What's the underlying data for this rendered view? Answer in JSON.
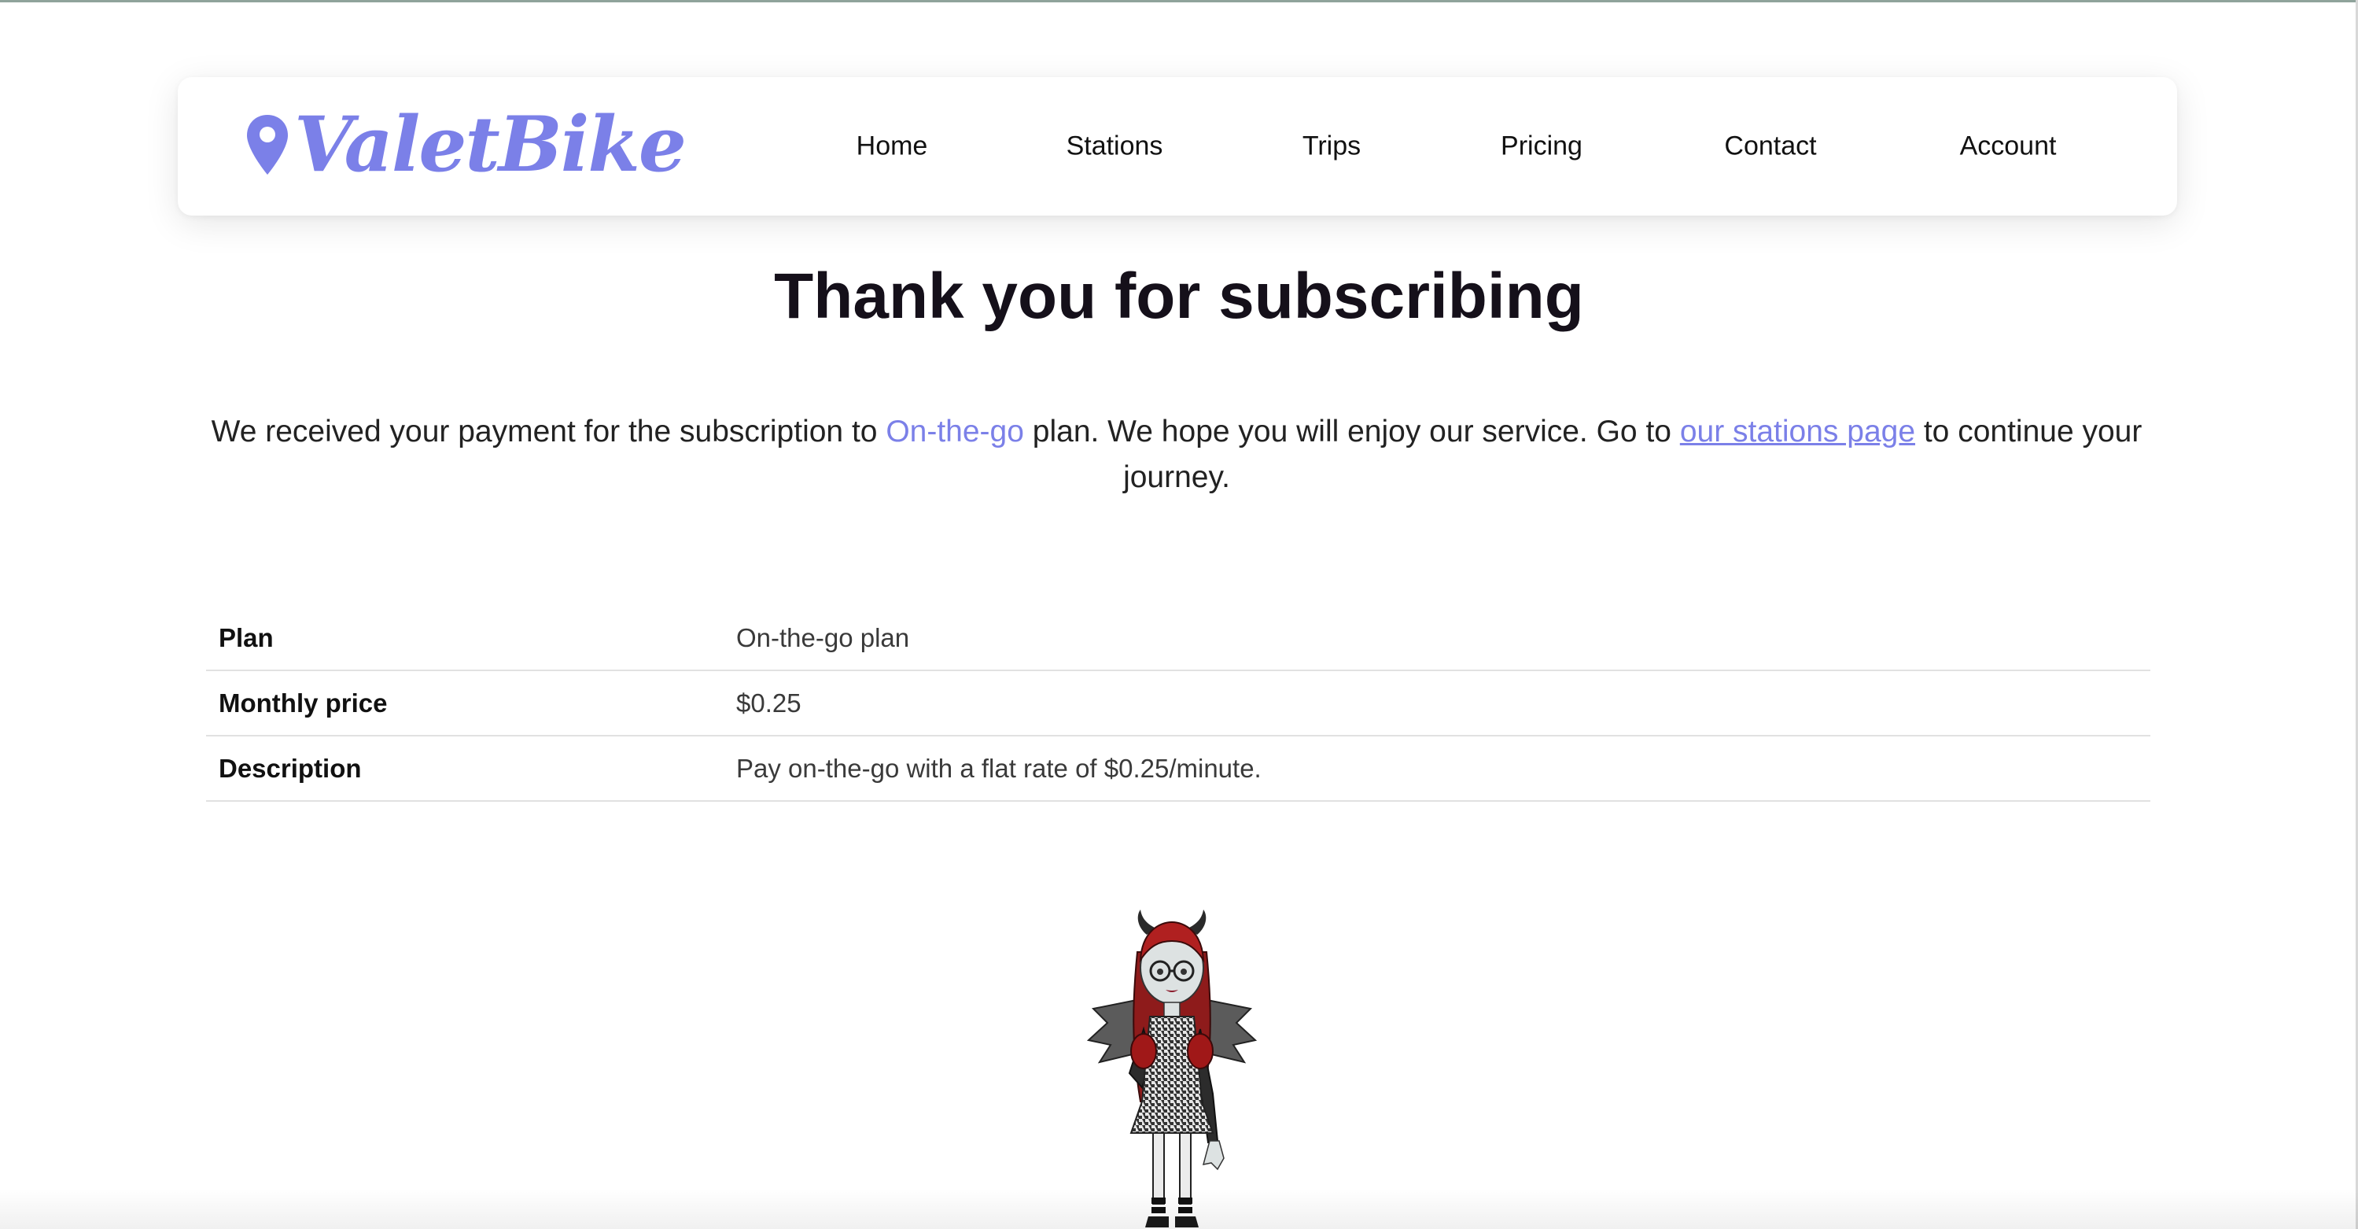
{
  "brand": {
    "name": "ValetBike",
    "color": "#7b80e8",
    "icon": "map-pin-icon"
  },
  "nav": {
    "items": [
      {
        "label": "Home"
      },
      {
        "label": "Stations"
      },
      {
        "label": "Trips"
      },
      {
        "label": "Pricing"
      },
      {
        "label": "Contact"
      },
      {
        "label": "Account"
      }
    ]
  },
  "main": {
    "title": "Thank you for subscribing",
    "intro": {
      "text_before": "We received your payment for the subscription to ",
      "plan_link": "On-the-go",
      "text_middle": " plan. We hope you will enjoy our service. Go to ",
      "stations_link": "our stations page",
      "text_after": " to continue your journey."
    },
    "details": [
      {
        "label": "Plan",
        "value": "On-the-go plan"
      },
      {
        "label": "Monthly price",
        "value": "$0.25"
      },
      {
        "label": "Description",
        "value": "Pay on-the-go with a flat rate of $0.25/minute."
      }
    ]
  },
  "mascot": {
    "icon": "mascot-character-illustration"
  }
}
